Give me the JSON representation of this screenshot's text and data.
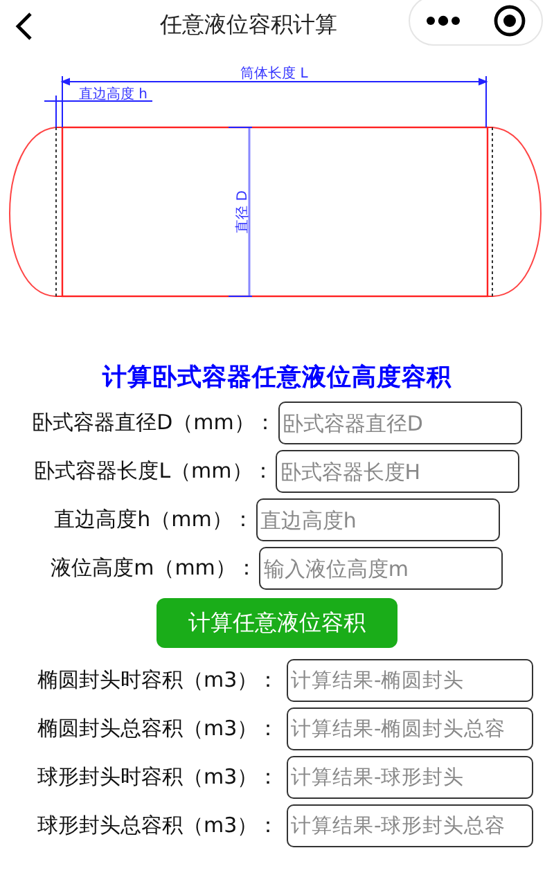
{
  "nav": {
    "title": "任意液位容积计算"
  },
  "diagram": {
    "length_label": "筒体长度 L",
    "straight_label": "直边高度 h",
    "diameter_label": "直径 D"
  },
  "heading": "计算卧式容器任意液位高度容积",
  "inputs": [
    {
      "label": "卧式容器直径D（mm）：",
      "placeholder": "卧式容器直径D"
    },
    {
      "label": "卧式容器长度L（mm）：",
      "placeholder": "卧式容器长度H"
    },
    {
      "label": "直边高度h（mm）：",
      "placeholder": "直边高度h"
    },
    {
      "label": "液位高度m（mm）：",
      "placeholder": "输入液位高度m"
    }
  ],
  "button": "计算任意液位容积",
  "results": [
    {
      "label": "椭圆封头时容积（m3）：",
      "placeholder": "计算结果-椭圆封头"
    },
    {
      "label": "椭圆封头总容积（m3）：",
      "placeholder": "计算结果-椭圆封头总容"
    },
    {
      "label": "球形封头时容积（m3）：",
      "placeholder": "计算结果-球形封头"
    },
    {
      "label": "球形封头总容积（m3）：",
      "placeholder": "计算结果-球形封头总容"
    }
  ]
}
